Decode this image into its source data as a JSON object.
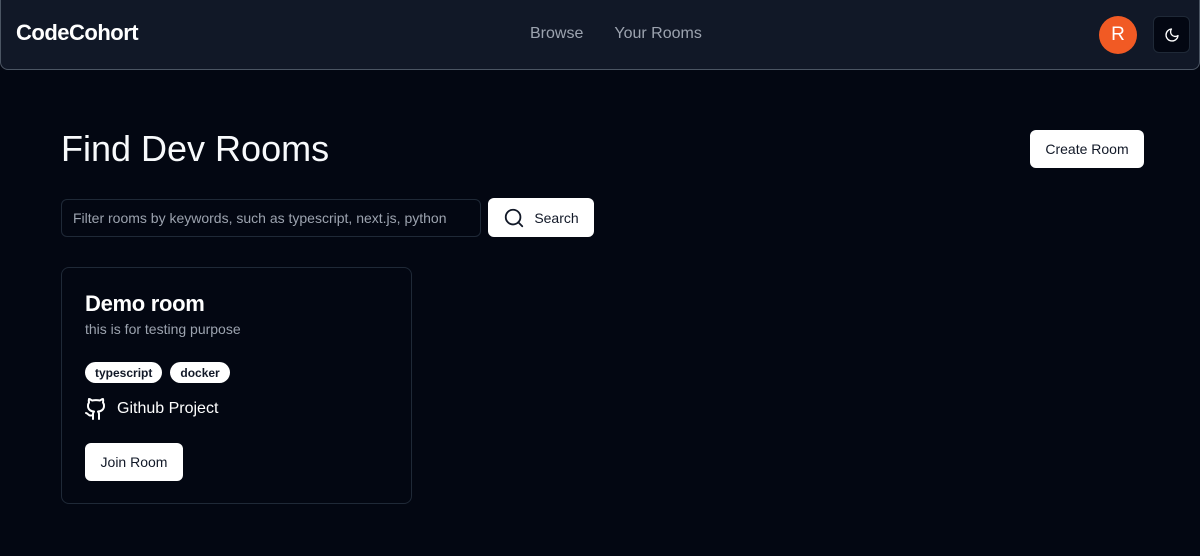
{
  "navbar": {
    "brand": "CodeCohort",
    "links": [
      {
        "label": "Browse"
      },
      {
        "label": "Your Rooms"
      }
    ],
    "avatar_initial": "R",
    "avatar_color": "#f15a24",
    "theme_icon": "moon-icon"
  },
  "main": {
    "title": "Find Dev Rooms",
    "create_label": "Create Room",
    "search": {
      "value": "",
      "placeholder": "Filter rooms by keywords, such as typescript, next.js, python",
      "button_label": "Search",
      "icon": "search-icon"
    },
    "rooms": [
      {
        "name": "Demo room",
        "description": "this is for testing purpose",
        "tags": [
          "typescript",
          "docker"
        ],
        "github_label": "Github Project",
        "github_icon": "github-icon",
        "join_label": "Join Room"
      }
    ]
  }
}
